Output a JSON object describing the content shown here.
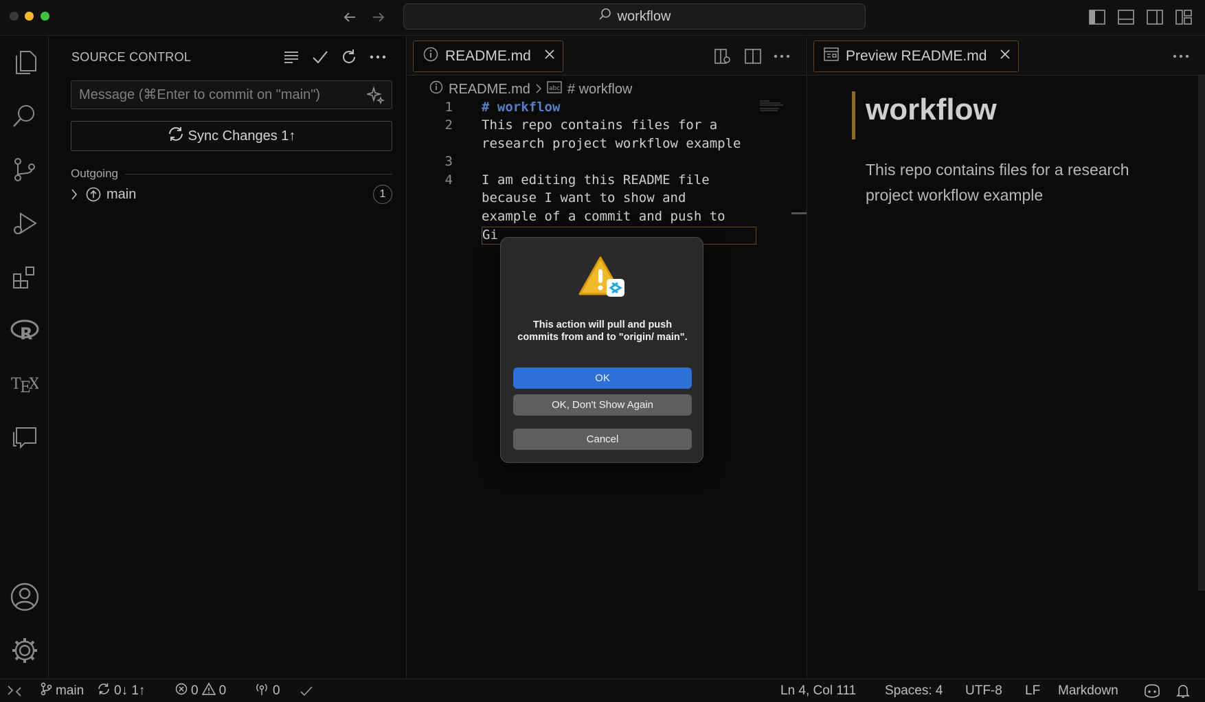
{
  "titlebar": {
    "search_text": "workflow"
  },
  "sidebar": {
    "title": "SOURCE CONTROL",
    "commit_placeholder": "Message (⌘Enter to commit on \"main\")",
    "sync_button": "Sync Changes 1↑",
    "outgoing_label": "Outgoing",
    "branch_name": "main",
    "branch_count": "1"
  },
  "editor": {
    "tab_label": "README.md",
    "breadcrumb_file": "README.md",
    "breadcrumb_heading": "# workflow",
    "lines": [
      {
        "num": "1",
        "text": "# workflow",
        "heading": true
      },
      {
        "num": "2",
        "text": "This repo contains files for a"
      },
      {
        "num": "",
        "text": "research project workflow example"
      },
      {
        "num": "3",
        "text": ""
      },
      {
        "num": "4",
        "text": "I am editing this README file"
      },
      {
        "num": "",
        "text": "because I want to show and"
      },
      {
        "num": "",
        "text": "example of a commit and push to"
      },
      {
        "num": "",
        "text": "Gi"
      }
    ]
  },
  "preview": {
    "tab_label": "Preview README.md",
    "heading": "workflow",
    "paragraph": "This repo contains files for a research project workflow example"
  },
  "dialog": {
    "message": "This action will pull and push commits from and to \"origin/ main\".",
    "ok": "OK",
    "ok_dont_show": "OK, Don't Show Again",
    "cancel": "Cancel"
  },
  "statusbar": {
    "branch": "main",
    "sync": "0↓ 1↑",
    "errors": "0",
    "warnings": "0",
    "ports": "0",
    "position": "Ln 4, Col 111",
    "spaces": "Spaces: 4",
    "encoding": "UTF-8",
    "eol": "LF",
    "language": "Markdown"
  },
  "colors": {
    "accent_blue": "#2f6fd8",
    "tab_border": "#5a4520",
    "traffic_red": "#3a3a3a",
    "traffic_yellow": "#f5b82e",
    "traffic_green": "#3cc43f"
  }
}
